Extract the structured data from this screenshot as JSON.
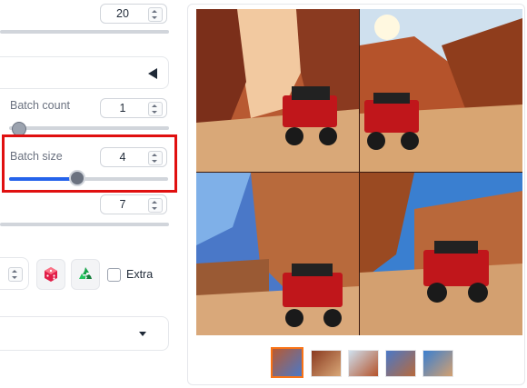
{
  "fields": {
    "top_value": "20",
    "batch_count_label": "Batch count",
    "batch_count_value": "1",
    "batch_size_label": "Batch size",
    "batch_size_value": "4",
    "seventh_value": "7"
  },
  "sliders": {
    "batch_count_fraction": 0.0,
    "batch_size_fraction": 0.43
  },
  "controls": {
    "extra_label": "Extra",
    "dice_icon": "dice-icon",
    "recycle_icon": "recycle-icon"
  },
  "colors": {
    "highlight_red": "#e01010",
    "slider_blue": "#2563eb",
    "selected_thumb_orange": "#f97316"
  },
  "gallery": {
    "images": [
      "jeep-canyon-1",
      "jeep-canyon-2",
      "jeep-canyon-3",
      "jeep-canyon-4"
    ],
    "selected_thumb": 0
  }
}
